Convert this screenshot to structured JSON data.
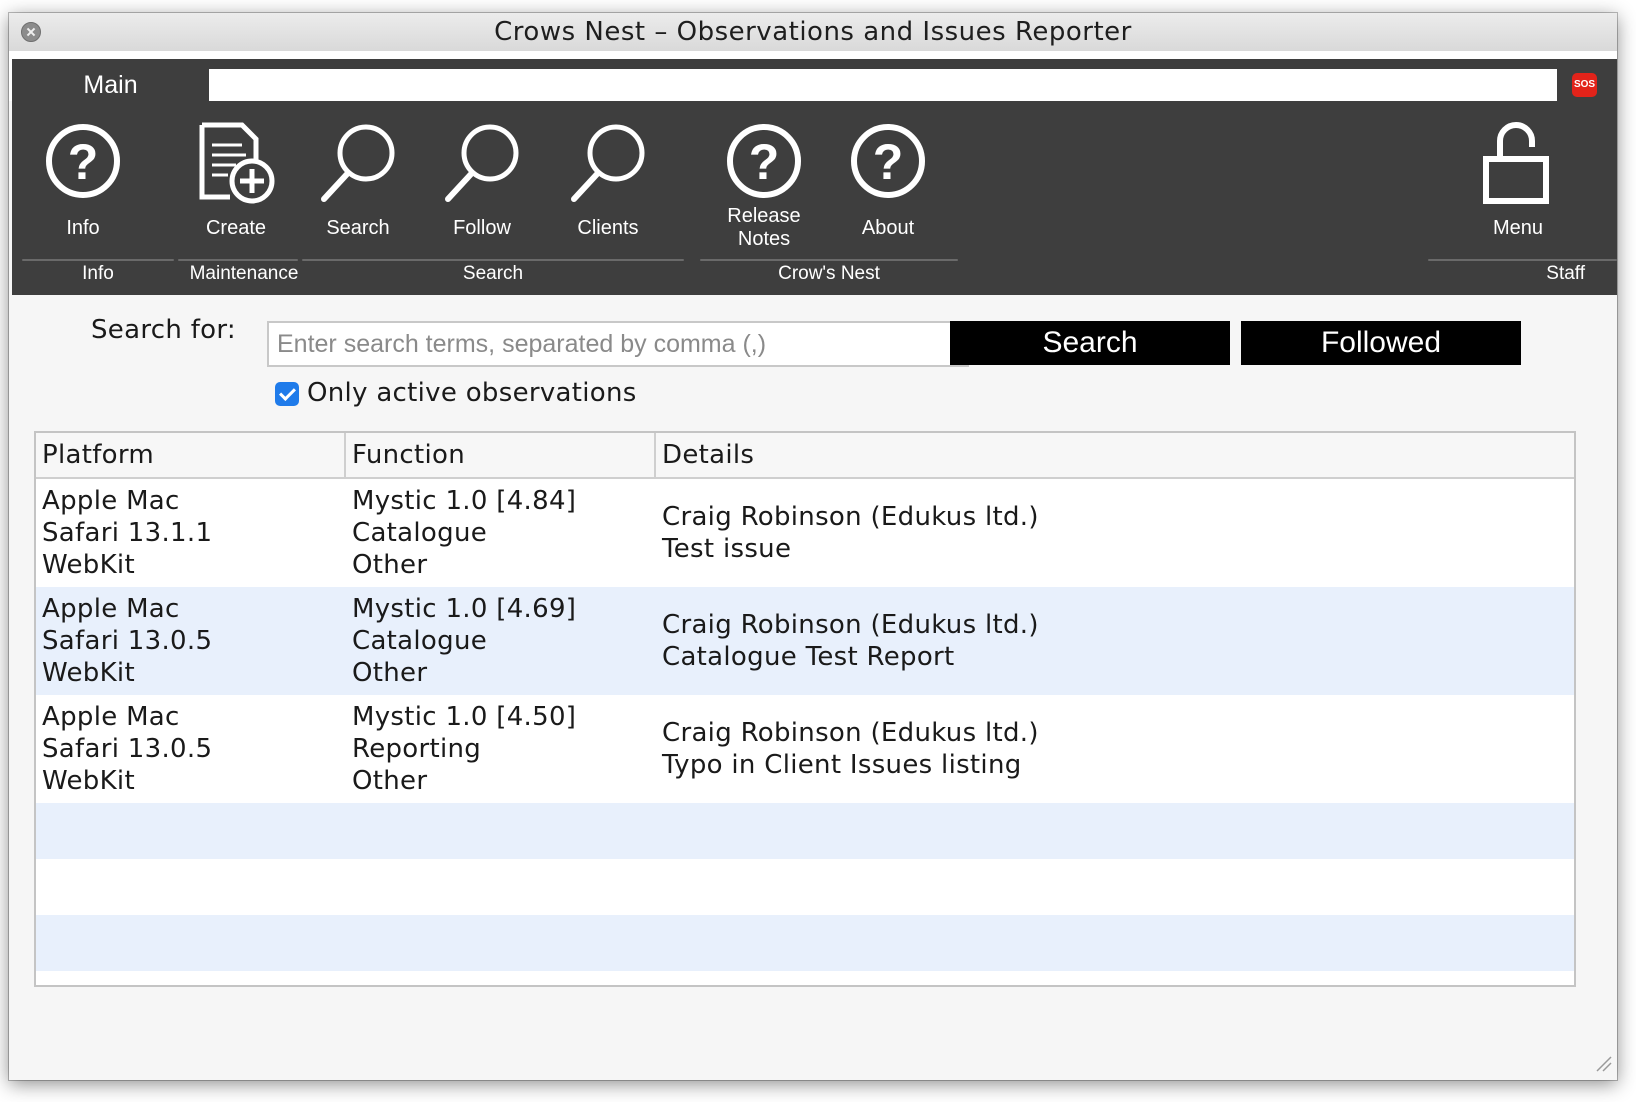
{
  "window": {
    "title": "Crows Nest – Observations and Issues Reporter"
  },
  "tabs": {
    "main_label": "Main"
  },
  "toolbar": {
    "tools": [
      {
        "label": "Info",
        "icon": "question-circle-icon"
      },
      {
        "label": "Create",
        "icon": "document-add-icon"
      },
      {
        "label": "Search",
        "icon": "magnifier-icon"
      },
      {
        "label": "Follow",
        "icon": "magnifier-icon"
      },
      {
        "label": "Clients",
        "icon": "magnifier-icon"
      },
      {
        "label_line1": "Release",
        "label_line2": "Notes",
        "icon": "question-circle-icon"
      },
      {
        "label": "About",
        "icon": "question-circle-icon"
      },
      {
        "label": "Menu",
        "icon": "padlock-icon"
      }
    ],
    "groups": [
      "Info",
      "Maintenance",
      "Search",
      "Crow's Nest",
      "Staff"
    ],
    "sos_label": "SOS"
  },
  "search": {
    "label": "Search for:",
    "placeholder": "Enter search terms, separated by comma (,)",
    "value": "",
    "search_button": "Search",
    "followed_button": "Followed",
    "checkbox_label": "Only active observations",
    "checkbox_checked": true
  },
  "table": {
    "headers": [
      "Platform",
      "Function",
      "Details"
    ],
    "rows": [
      {
        "platform": [
          "Apple Mac",
          "Safari 13.1.1",
          "WebKit"
        ],
        "function": [
          "Mystic 1.0 [4.84]",
          "Catalogue",
          "Other"
        ],
        "details": [
          "Craig Robinson (Edukus ltd.)",
          "Test issue"
        ]
      },
      {
        "platform": [
          "Apple Mac",
          "Safari 13.0.5",
          "WebKit"
        ],
        "function": [
          "Mystic 1.0 [4.69]",
          "Catalogue",
          "Other"
        ],
        "details": [
          "Craig Robinson (Edukus ltd.)",
          "Catalogue Test Report"
        ]
      },
      {
        "platform": [
          "Apple Mac",
          "Safari 13.0.5",
          "WebKit"
        ],
        "function": [
          "Mystic 1.0 [4.50]",
          "Reporting",
          "Other"
        ],
        "details": [
          "Craig Robinson (Edukus ltd.)",
          "Typo in Client Issues listing"
        ]
      }
    ]
  },
  "colors": {
    "ribbon": "#3e3e3e",
    "row_alt": "#e8f0fc",
    "checkbox": "#1f7bea",
    "sos": "#e2231a",
    "button": "#000000"
  }
}
